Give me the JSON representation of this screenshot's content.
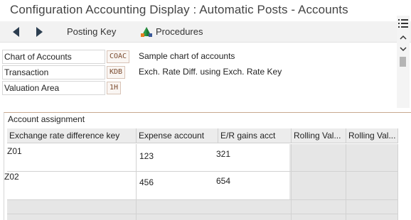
{
  "window": {
    "title": "Configuration Accounting Display : Automatic Posts - Accounts"
  },
  "toolbar": {
    "back_icon": "arrow-left-icon",
    "forward_icon": "arrow-right-icon",
    "posting_key_label": "Posting Key",
    "procedures_label": "Procedures",
    "procedures_icon": "hierarchy-icon"
  },
  "fields": [
    {
      "label": "Chart of Accounts",
      "value": "COAC",
      "description": "Sample chart of accounts"
    },
    {
      "label": "Transaction",
      "value": "KDB",
      "description": "Exch. Rate Diff. using Exch. Rate Key"
    },
    {
      "label": "Valuation Area",
      "value": "1H",
      "description": ""
    }
  ],
  "table": {
    "title": "Account assignment",
    "columns": [
      "Exchange rate difference key",
      "Expense account",
      "E/R gains acct",
      "Rolling Val...",
      "Rolling Val..."
    ],
    "rows": [
      {
        "key": "Z01",
        "expense": "123",
        "gains": "321"
      },
      {
        "key": "Z02",
        "expense": "456",
        "gains": "654"
      }
    ],
    "settings_icon": "table-settings-icon",
    "scroll_up_icon": "chevron-up-icon",
    "scroll_down_icon": "chevron-down-icon"
  },
  "colors": {
    "accent": "#c8a98f",
    "icon_dark": "#2c3e50",
    "proc_green": "#2e9b47",
    "proc_orange": "#e67e22"
  }
}
